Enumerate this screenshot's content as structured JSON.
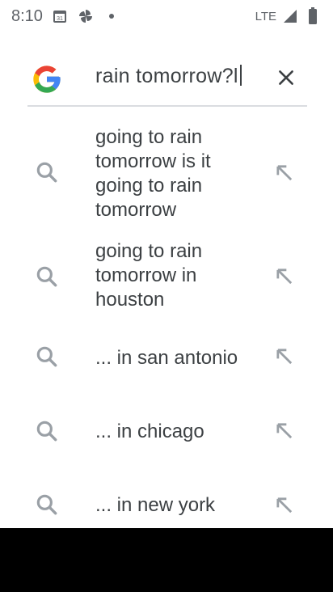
{
  "status_bar": {
    "time": "8:10",
    "network": "LTE"
  },
  "search": {
    "query": "rain tomorrow?l"
  },
  "suggestions": [
    {
      "text": "going to rain tomorrow is it going to rain tomorrow"
    },
    {
      "text": "going to rain tomorrow in houston"
    },
    {
      "text": "... in san antonio"
    },
    {
      "text": "... in chicago"
    },
    {
      "text": "... in new york"
    }
  ],
  "colors": {
    "google_blue": "#4285F4",
    "google_red": "#EA4335",
    "google_yellow": "#FBBC05",
    "google_green": "#34A853",
    "icon_gray": "#9aa0a6"
  }
}
